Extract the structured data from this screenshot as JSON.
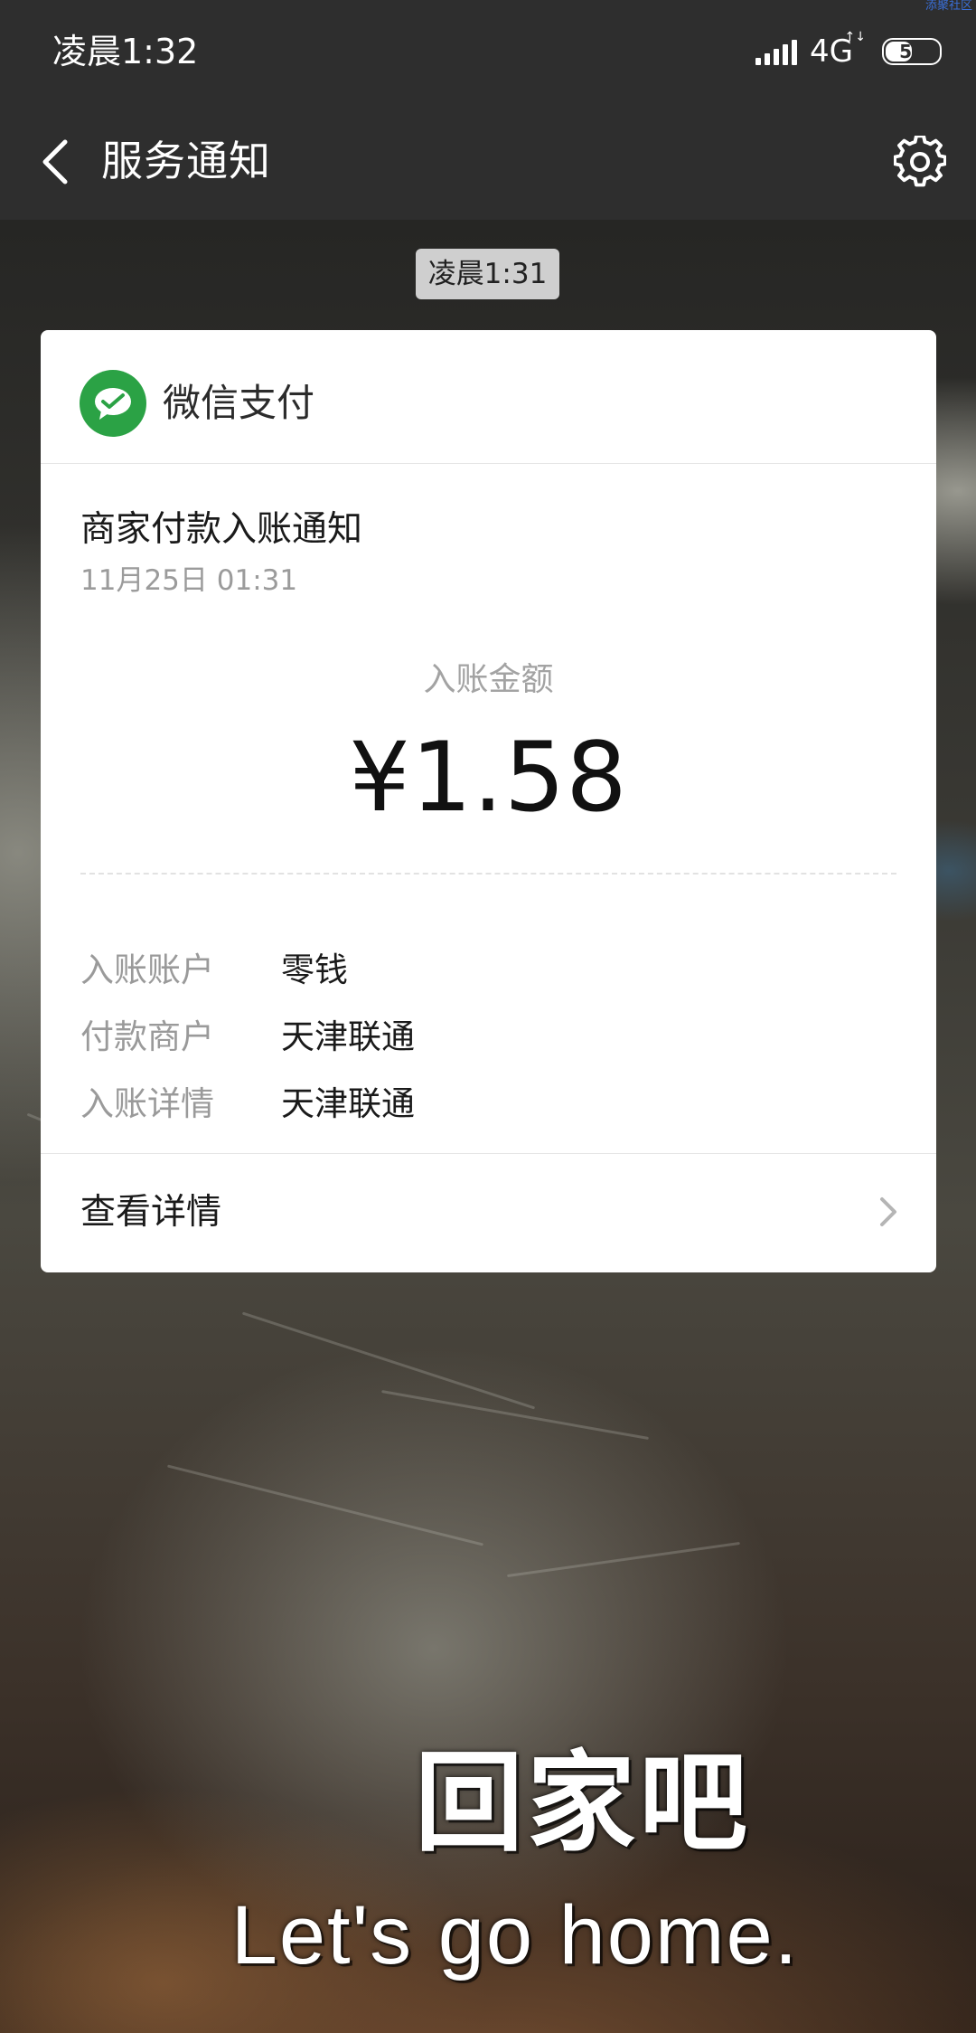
{
  "status_bar": {
    "time": "凌晨1:32",
    "network": "4G",
    "network_arrows": "↑↓",
    "battery_level": "54",
    "battery_fraction": 0.54,
    "watermark": "添聚社区"
  },
  "title_bar": {
    "title": "服务通知",
    "back_icon": "chevron-left-icon",
    "settings_icon": "gear-icon"
  },
  "chat": {
    "timestamp": "凌晨1:31"
  },
  "card": {
    "header_label": "微信支付",
    "logo_icon": "wechat-pay-icon",
    "notice_title": "商家付款入账通知",
    "notice_date": "11月25日 01:31",
    "amount_label": "入账金额",
    "amount_value": "¥1.58",
    "details": [
      {
        "key": "入账账户",
        "value": "零钱"
      },
      {
        "key": "付款商户",
        "value": "天津联通"
      },
      {
        "key": "入账详情",
        "value": "天津联通"
      }
    ],
    "footer_label": "查看详情",
    "footer_icon": "chevron-right-icon"
  },
  "subtitles": {
    "chinese": "回家吧",
    "english": "Let's go home."
  },
  "colors": {
    "bar_background": "#2e2e2e",
    "wechat_green": "#2ba245",
    "card_background": "#ffffff",
    "secondary_text": "#9b9b9b"
  }
}
